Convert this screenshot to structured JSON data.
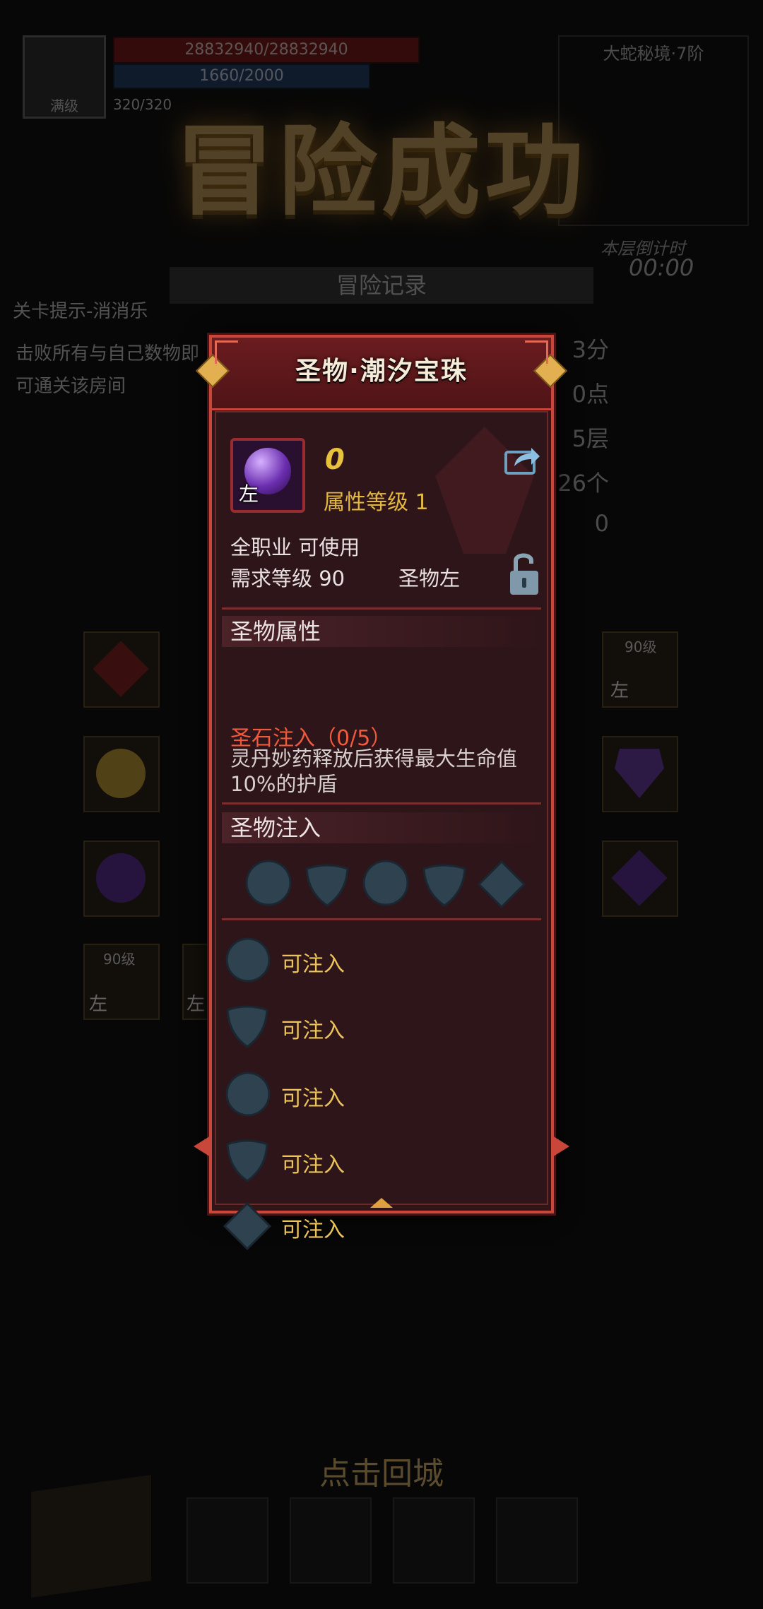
{
  "background": {
    "hp_text": "28832940/28832940",
    "mp_text": "1660/2000",
    "energy_text": "320/320",
    "avatar_label": "满级",
    "dungeon_name": "大蛇秘境·7阶",
    "banner_title": "冒险成功",
    "timer_label": "本层倒计时",
    "timer_value": "00:00",
    "records_header": "冒险记录",
    "hint_title": "关卡提示-消消乐",
    "hint_body": "击败所有与自己数物即可通关该房间",
    "stats": [
      "3分",
      "0点",
      "5层",
      "26个",
      "0"
    ],
    "slot_tags": [
      "90级",
      "90级"
    ],
    "slot_side_labels": [
      "左",
      "左",
      "左"
    ],
    "back_to_town": "点击回城"
  },
  "panel": {
    "title": "圣物·潮汐宝珠",
    "item_icon": "purple-orb-icon",
    "item_side_tag": "左",
    "enhance_level": "0",
    "attribute_level": "属性等级 1",
    "class_usable": "全职业 可使用",
    "required_level": "需求等级 90",
    "slot_name": "圣物左",
    "share_icon": "share-icon",
    "lock_icon": "unlocked-padlock-icon",
    "attributes_section": {
      "title": "圣物属性",
      "property_name": "圣石注入（0/5）",
      "property_desc": "灵丹妙药释放后获得最大生命值10%的护盾"
    },
    "inject_section": {
      "title": "圣物注入",
      "sockets": [
        "circle",
        "shield",
        "circle",
        "shield",
        "diamond"
      ]
    },
    "inject_rows": [
      {
        "shape": "circle",
        "label": "可注入"
      },
      {
        "shape": "shield",
        "label": "可注入"
      },
      {
        "shape": "circle",
        "label": "可注入"
      },
      {
        "shape": "shield",
        "label": "可注入"
      },
      {
        "shape": "diamond",
        "label": "可注入"
      }
    ],
    "colors": {
      "frame": "#c8463a",
      "panel_bg": "#2e1519",
      "socket_fill": "#2f4250",
      "accent_gold": "#e2b83e",
      "property_red": "#ef5a3c"
    }
  }
}
